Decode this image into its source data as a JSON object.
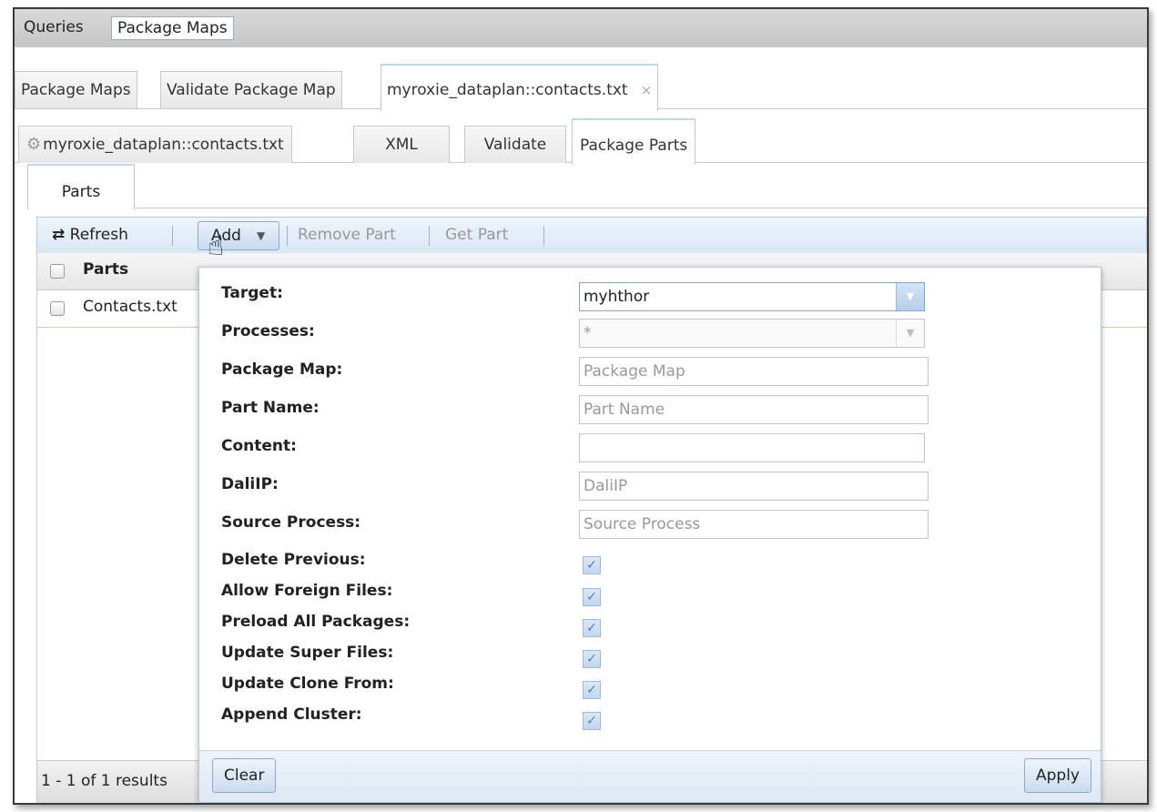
{
  "topbar": {
    "tabs": [
      "Queries",
      "Package Maps"
    ]
  },
  "tabs_level1": {
    "items": [
      "Package Maps",
      "Validate Package Map",
      "myroxie_dataplan::contacts.txt"
    ],
    "close_icon": "×"
  },
  "tabs_level2": {
    "items": [
      "myroxie_dataplan::contacts.txt",
      "XML",
      "Validate",
      "Package Parts"
    ]
  },
  "tabs_level3": {
    "items": [
      "Parts"
    ]
  },
  "toolbar": {
    "refresh_label": "Refresh",
    "add_label": "Add",
    "remove_label": "Remove Part",
    "get_label": "Get Part"
  },
  "grid": {
    "header": "Parts",
    "rows": [
      "Contacts.txt"
    ],
    "footer": "1 - 1 of 1 results"
  },
  "form": {
    "fields": {
      "target": {
        "label": "Target:",
        "value": "myhthor"
      },
      "processes": {
        "label": "Processes:",
        "value": "*"
      },
      "package_map": {
        "label": "Package Map:",
        "placeholder": "Package Map"
      },
      "part_name": {
        "label": "Part Name:",
        "placeholder": "Part Name"
      },
      "content": {
        "label": "Content:",
        "value": ""
      },
      "daliip": {
        "label": "DaliIP:",
        "placeholder": "DaliIP"
      },
      "source_process": {
        "label": "Source Process:",
        "placeholder": "Source Process"
      }
    },
    "checkboxes": [
      {
        "label": "Delete Previous:",
        "checked": true
      },
      {
        "label": "Allow Foreign Files:",
        "checked": true
      },
      {
        "label": "Preload All Packages:",
        "checked": true
      },
      {
        "label": "Update Super Files:",
        "checked": true
      },
      {
        "label": "Update Clone From:",
        "checked": true
      },
      {
        "label": "Append Cluster:",
        "checked": true
      }
    ],
    "clear_label": "Clear",
    "apply_label": "Apply"
  },
  "icons": {
    "refresh": "⇄",
    "gear": "⚙",
    "caret": "▼",
    "check": "✓",
    "cursor": "☝"
  }
}
